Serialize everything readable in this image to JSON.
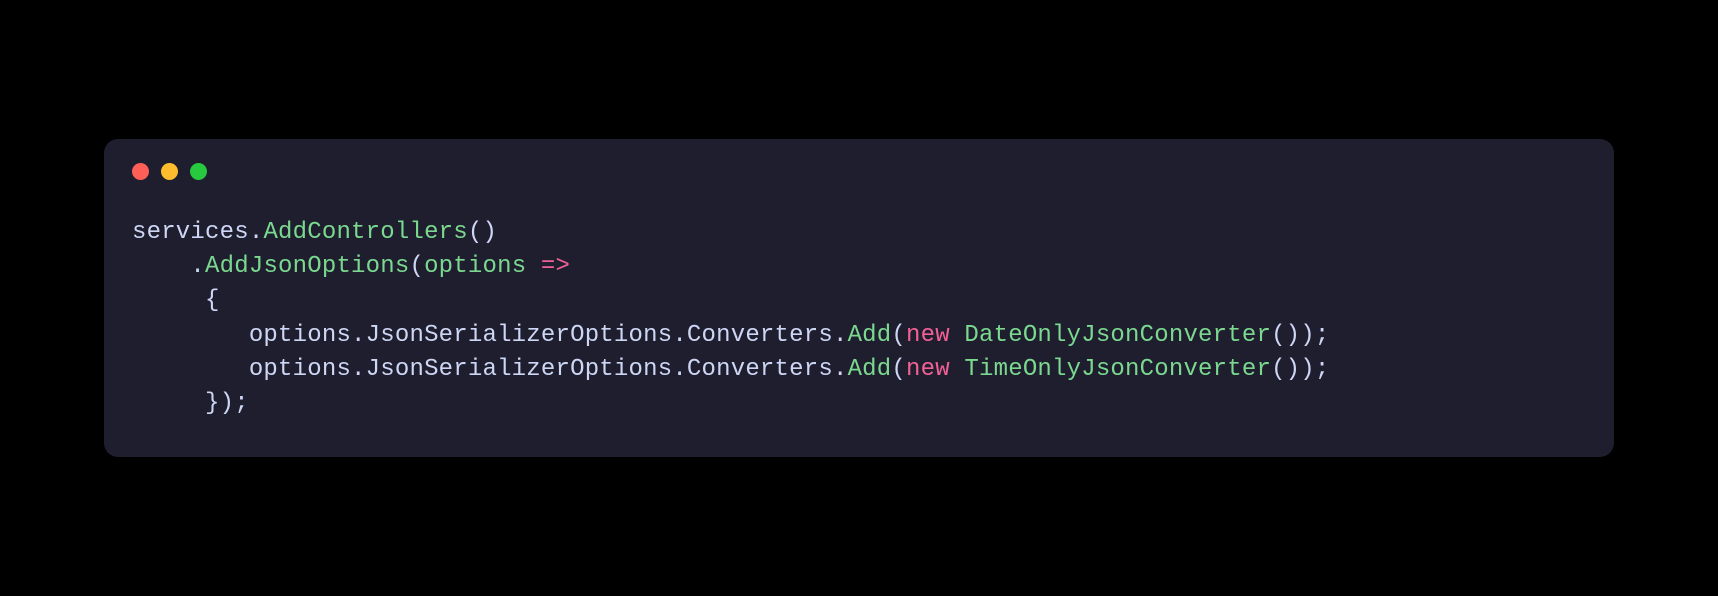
{
  "window": {
    "dots": [
      "red",
      "yellow",
      "green"
    ]
  },
  "code": {
    "tokens": {
      "services": "services",
      "dot": ".",
      "AddControllers": "AddControllers",
      "lparen": "(",
      "rparen": ")",
      "AddJsonOptions": "AddJsonOptions",
      "options": "options",
      "arrow": "=>",
      "lbrace": "{",
      "rbrace": "}",
      "JsonSerializerOptions": "JsonSerializerOptions",
      "Converters": "Converters",
      "Add": "Add",
      "new": "new",
      "DateOnlyJsonConverter": "DateOnlyJsonConverter",
      "TimeOnlyJsonConverter": "TimeOnlyJsonConverter",
      "semi": ";"
    },
    "indent1": "    ",
    "indent2": "     ",
    "indent3": "        "
  }
}
